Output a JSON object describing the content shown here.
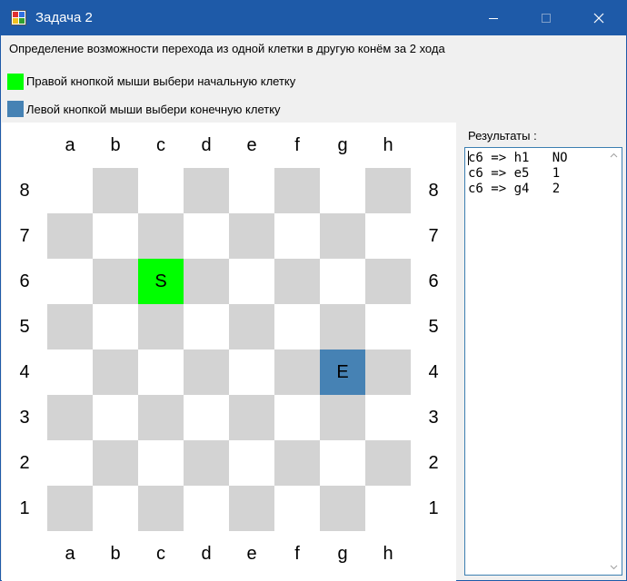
{
  "window": {
    "title": "Задача 2"
  },
  "description": "Определение возможности перехода из одной клетки в другую конём за 2 хода",
  "legend": {
    "start_label": "Правой кнопкой мыши выбери начальную клетку",
    "start_color": "#00ff00",
    "end_label": "Левой кнопкой мыши выбери конечную клетку",
    "end_color": "#4682b4"
  },
  "board": {
    "files": [
      "a",
      "b",
      "c",
      "d",
      "e",
      "f",
      "g",
      "h"
    ],
    "ranks": [
      "8",
      "7",
      "6",
      "5",
      "4",
      "3",
      "2",
      "1"
    ],
    "light_color": "#ffffff",
    "dark_color": "#d3d3d3",
    "start_square": "c6",
    "start_marker": "S",
    "end_square": "g4",
    "end_marker": "E"
  },
  "results": {
    "label": "Результаты :",
    "lines": [
      "c6 => h1   NO",
      "c6 => e5   1",
      "c6 => g4   2"
    ]
  }
}
